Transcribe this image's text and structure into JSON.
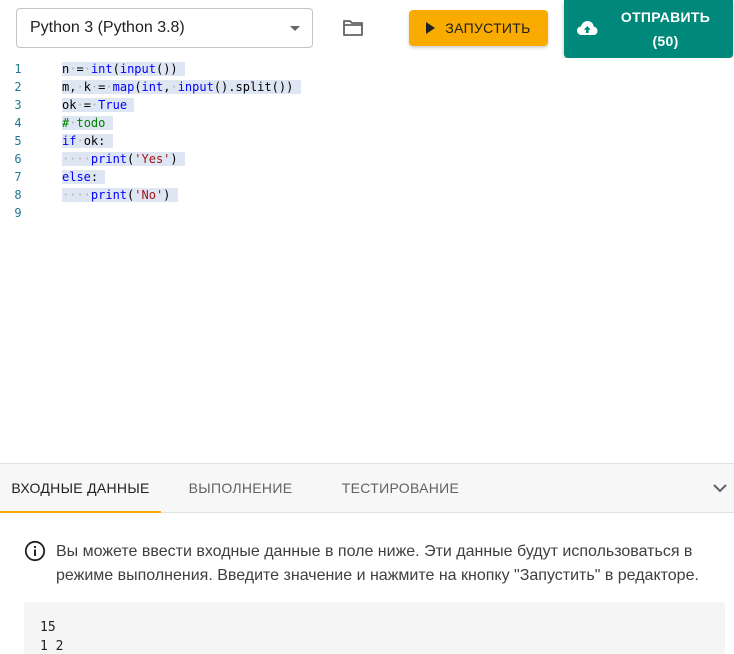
{
  "toolbar": {
    "language": "Python 3 (Python 3.8)",
    "run_label": "ЗАПУСТИТЬ",
    "submit_label": "ОТПРАВИТЬ",
    "submit_count": "(50)",
    "accent_run": "#f9ab00",
    "accent_submit": "#00897b"
  },
  "editor": {
    "lines": [
      {
        "num": "1",
        "code": "n = int(input())"
      },
      {
        "num": "2",
        "code": "m, k = map(int, input().split())"
      },
      {
        "num": "3",
        "code": "ok = True"
      },
      {
        "num": "4",
        "code": "# todo"
      },
      {
        "num": "5",
        "code": "if ok:"
      },
      {
        "num": "6",
        "code": "    print('Yes')"
      },
      {
        "num": "7",
        "code": "else:"
      },
      {
        "num": "8",
        "code": "    print('No')"
      },
      {
        "num": "9",
        "code": ""
      }
    ]
  },
  "panel": {
    "tabs": [
      {
        "label": "ВХОДНЫЕ ДАННЫЕ",
        "active": true
      },
      {
        "label": "ВЫПОЛНЕНИЕ",
        "active": false
      },
      {
        "label": "ТЕСТИРОВАНИЕ",
        "active": false
      }
    ],
    "info_text": "Вы можете ввести входные данные в поле ниже. Эти данные будут использоваться в режиме выполнения. Введите значение и нажмите на кнопку \"Запустить\" в редакторе.",
    "input_value": "15\n1 2"
  }
}
